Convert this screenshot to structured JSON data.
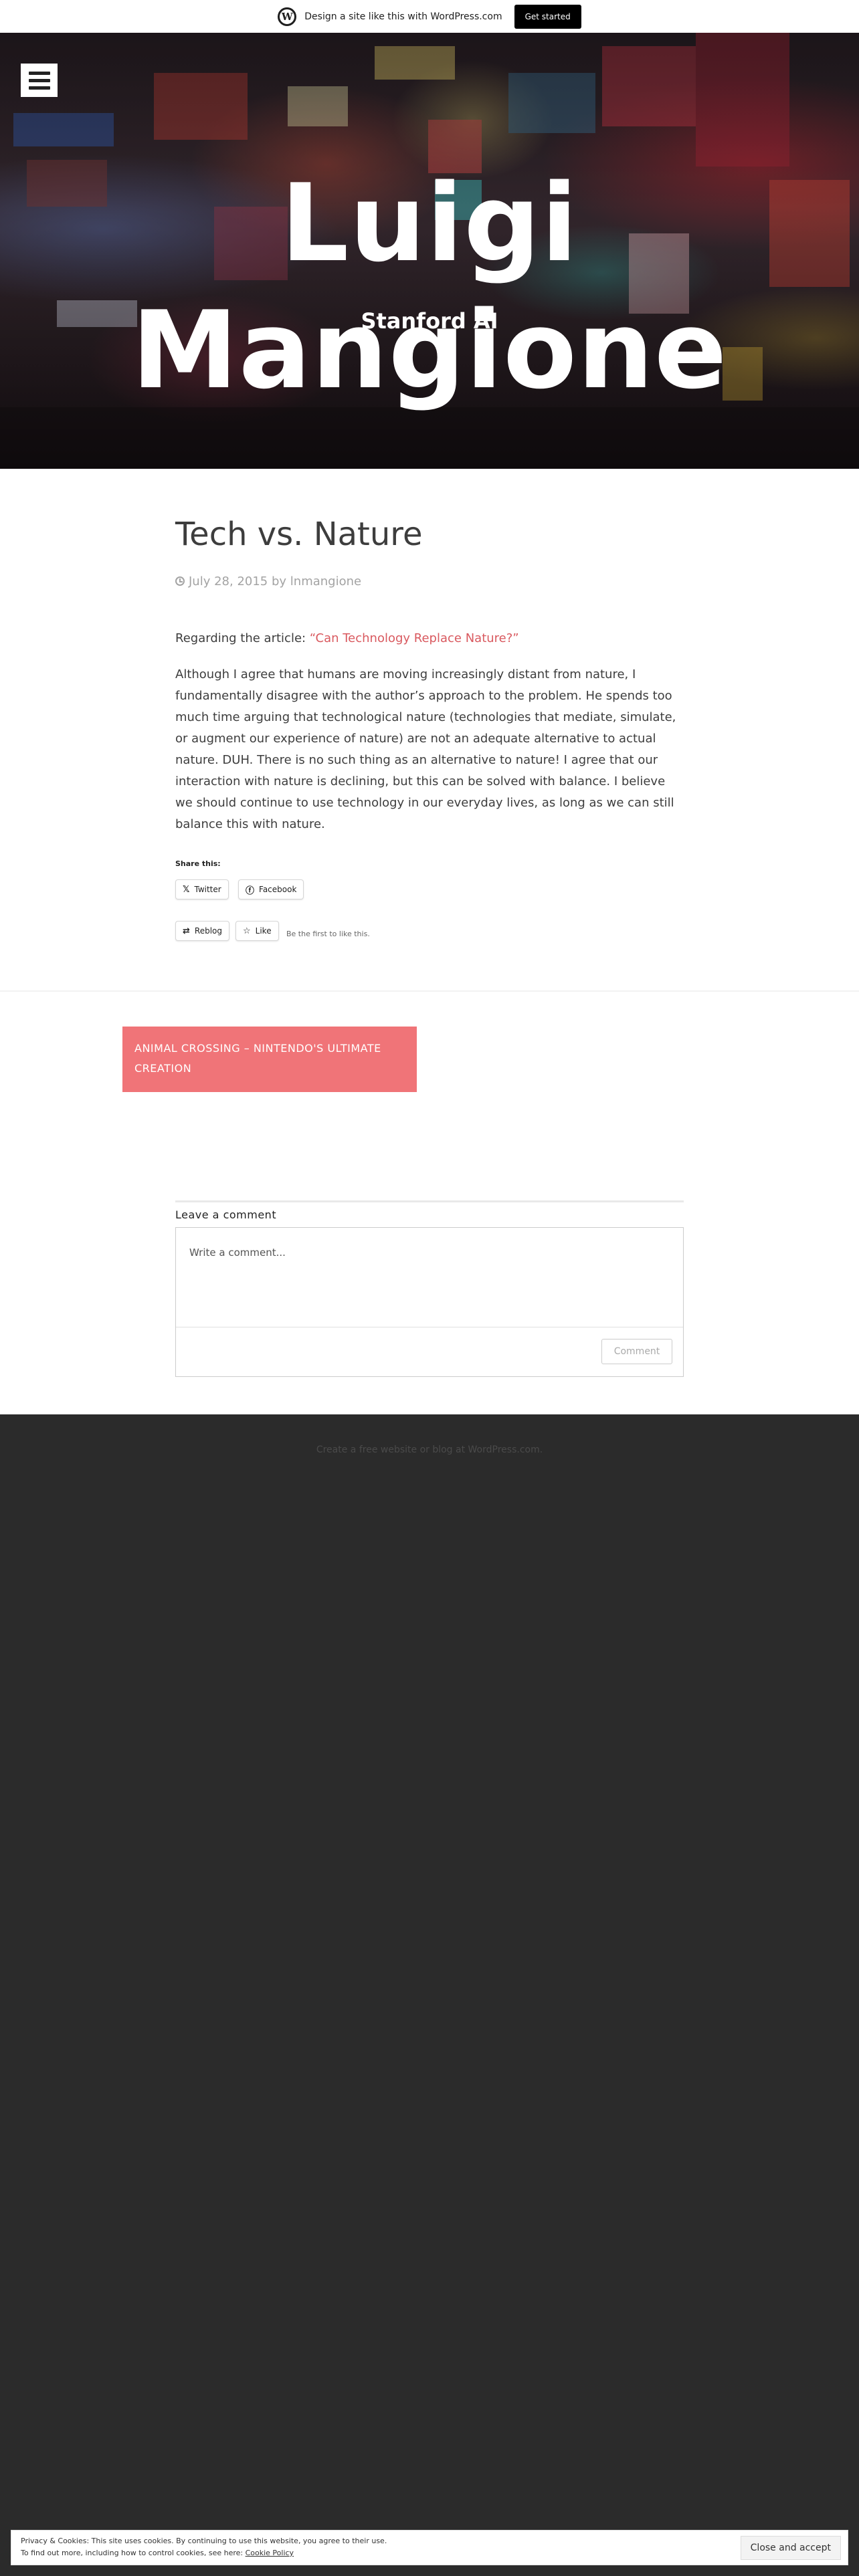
{
  "wpbar": {
    "logo": "W",
    "text": "Design a site like this with WordPress.com",
    "cta": "Get started"
  },
  "header": {
    "menu_icon": "hamburger-menu-icon",
    "site_title": "Luigi Mangione",
    "site_description": "Stanford AI"
  },
  "post": {
    "title": "Tech vs. Nature",
    "date": "July 28, 2015",
    "by": "by",
    "author": "lnmangione",
    "intro_prefix": "Regarding the article: ",
    "intro_link": "“Can Technology Replace Nature?”",
    "body": "Although I agree that humans are moving increasingly distant from nature, I fundamentally disagree with the author’s approach to the problem. He spends too much time arguing that technological nature (technologies that mediate, simulate, or augment our experience of nature) are not an adequate alternative to actual nature. DUH. There is no such thing as an alternative to nature! I agree that our interaction with nature is declining, but this can be solved with balance. I believe we should continue to use technology in our everyday lives, as long as we can still balance this with nature."
  },
  "share": {
    "title": "Share this:",
    "twitter": "Twitter",
    "facebook": "Facebook",
    "reblog": "Reblog",
    "like": "Like",
    "like_note": "Be the first to like this."
  },
  "nav": {
    "previous": "ANIMAL CROSSING – NINTENDO'S ULTIMATE CREATION"
  },
  "comments": {
    "reply_title": "Leave a comment",
    "placeholder": "Write a comment...",
    "submit": "Comment"
  },
  "footer": {
    "credit": "Create a free website or blog at WordPress.com."
  },
  "cookie": {
    "line1": "Privacy & Cookies: This site uses cookies. By continuing to use this website, you agree to their use.",
    "line2_prefix": "To find out more, including how to control cookies, see here: ",
    "line2_link": "Cookie Policy",
    "button": "Close and accept"
  },
  "colors": {
    "accent": "#f07478",
    "link": "#d9595f",
    "footer_bg": "#2b2b2b"
  }
}
